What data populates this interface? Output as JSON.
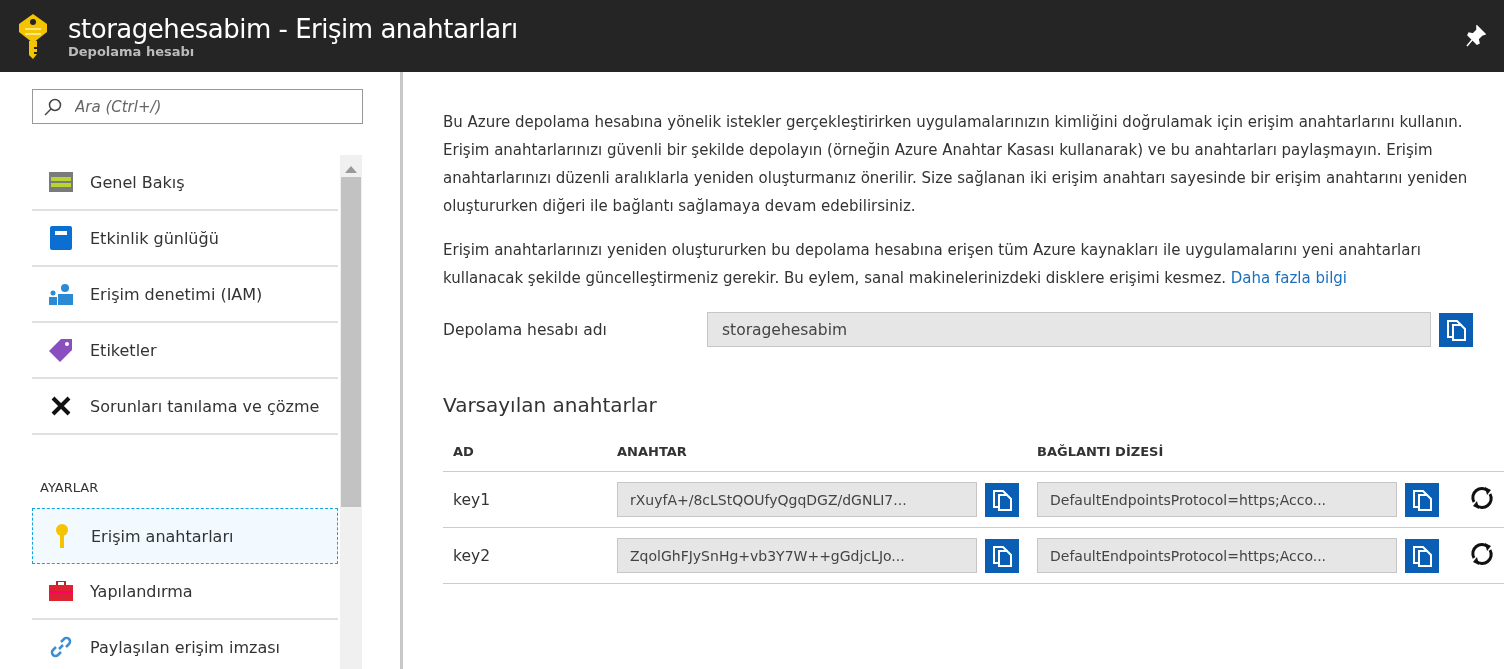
{
  "header": {
    "title": "storagehesabim - Erişim anahtarları",
    "subtitle": "Depolama hesabı"
  },
  "search": {
    "placeholder": "Ara (Ctrl+/)"
  },
  "nav": [
    {
      "kind": "item",
      "label": "Genel Bakış",
      "selected": false
    },
    {
      "kind": "item",
      "label": "Etkinlik günlüğü",
      "selected": false
    },
    {
      "kind": "item",
      "label": "Erişim denetimi (IAM)",
      "selected": false
    },
    {
      "kind": "item",
      "label": "Etiketler",
      "selected": false
    },
    {
      "kind": "item",
      "label": "Sorunları tanılama ve çözme",
      "selected": false
    },
    {
      "kind": "section",
      "label": "AYARLAR"
    },
    {
      "kind": "item",
      "label": "Erişim anahtarları",
      "selected": true
    },
    {
      "kind": "item",
      "label": "Yapılandırma",
      "selected": false
    },
    {
      "kind": "item",
      "label": "Paylaşılan erişim imzası",
      "selected": false
    }
  ],
  "intro": [
    {
      "text": "Bu Azure depolama hesabına yönelik istekler gerçekleştirirken uygulamalarınızın kimliğini doğrulamak için erişim anahtarlarını kullanın. Erişim anahtarlarınızı güvenli bir şekilde depolayın (örneğin Azure Anahtar Kasası kullanarak) ve bu anahtarları paylaşmayın. Erişim anahtarlarınızı düzenli aralıklarla yeniden oluşturmanız önerilir. Size sağlanan iki erişim anahtarı sayesinde bir erişim anahtarını yeniden oluştururken diğeri ile bağlantı sağlamaya devam edebilirsiniz."
    },
    {
      "text": "Erişim anahtarlarınızı yeniden oluştururken bu depolama hesabına erişen tüm Azure kaynakları ile uygulamalarını yeni anahtarları kullanacak şekilde güncelleştirmeniz gerekir. Bu eylem, sanal makinelerinizdeki disklere erişimi kesmez.",
      "link": "Daha fazla bilgi"
    }
  ],
  "account": {
    "label": "Depolama hesabı adı",
    "value": "storagehesabim"
  },
  "keys": {
    "title": "Varsayılan anahtarlar",
    "columns": [
      "AD",
      "ANAHTAR",
      "BAĞLANTI DİZESİ"
    ],
    "rows": [
      {
        "name": "key1",
        "key": "rXuyfA+/8cLStQOUfyQgqDGZ/dGNLI7...",
        "connection": "DefaultEndpointsProtocol=https;Acco..."
      },
      {
        "name": "key2",
        "key": "ZqolGhFJySnHg+vb3Y7W++gGdjcLJo...",
        "connection": "DefaultEndpointsProtocol=https;Acco..."
      }
    ]
  }
}
